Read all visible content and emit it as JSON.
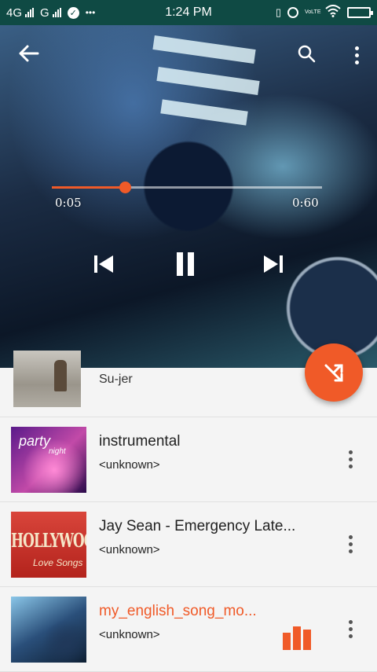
{
  "status_bar": {
    "network_1": "4G",
    "network_2": "G",
    "overflow": "•••",
    "time": "1:24 PM",
    "volte": "VoLTE"
  },
  "player": {
    "current_time": "0:05",
    "duration": "0:60",
    "progress": 0.27,
    "icons": {
      "back": "arrow-left",
      "search": "magnifier",
      "more": "three-dots-vertical",
      "previous": "skip-previous",
      "pause": "pause",
      "next": "skip-next",
      "shuffle": "shuffle"
    },
    "accent_color": "#f05a28"
  },
  "songs": [
    {
      "title": "Su-jer",
      "artist": "",
      "playing": false
    },
    {
      "title": "instrumental",
      "artist": "<unknown>",
      "playing": false,
      "art_text": [
        "party",
        "night"
      ]
    },
    {
      "title": "Jay Sean - Emergency Late...",
      "artist": "<unknown>",
      "playing": false,
      "art_text": [
        "HOLLYWOOD",
        "Love Songs"
      ]
    },
    {
      "title": "my_english_song_mo...",
      "artist": "<unknown>",
      "playing": true
    }
  ]
}
